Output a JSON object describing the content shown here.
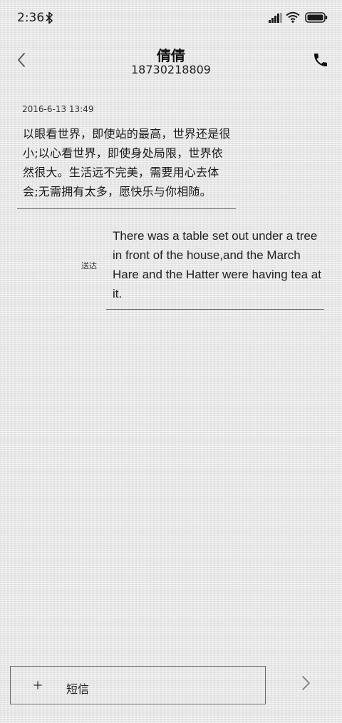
{
  "status_bar": {
    "time": "2:36",
    "icons": [
      "bluetooth-icon",
      "signal-icon",
      "wifi-icon",
      "battery-icon"
    ]
  },
  "header": {
    "contact_name": "倩倩",
    "phone_number": "18730218809",
    "back_icon": "chevron-left-icon",
    "call_icon": "phone-icon"
  },
  "messages": [
    {
      "direction": "incoming",
      "timestamp": "2016-6-13 13:49",
      "text": "以眼看世界，即使站的最高，世界还是很小;以心看世界，即使身处局限，世界依然很大。生活远不完美，需要用心去体会;无需拥有太多，愿快乐与你相随。"
    },
    {
      "direction": "outgoing",
      "status": "送达",
      "text": "There was a table set out under a tree in front of the house,and the March Hare and the Hatter were having tea at it."
    }
  ],
  "composer": {
    "attach_icon": "plus-icon",
    "placeholder": "短信",
    "send_icon": "chevron-right-icon"
  },
  "colors": {
    "background": "#e9e9e9",
    "text": "#1a1a1a",
    "rule": "#6f6f6f"
  }
}
